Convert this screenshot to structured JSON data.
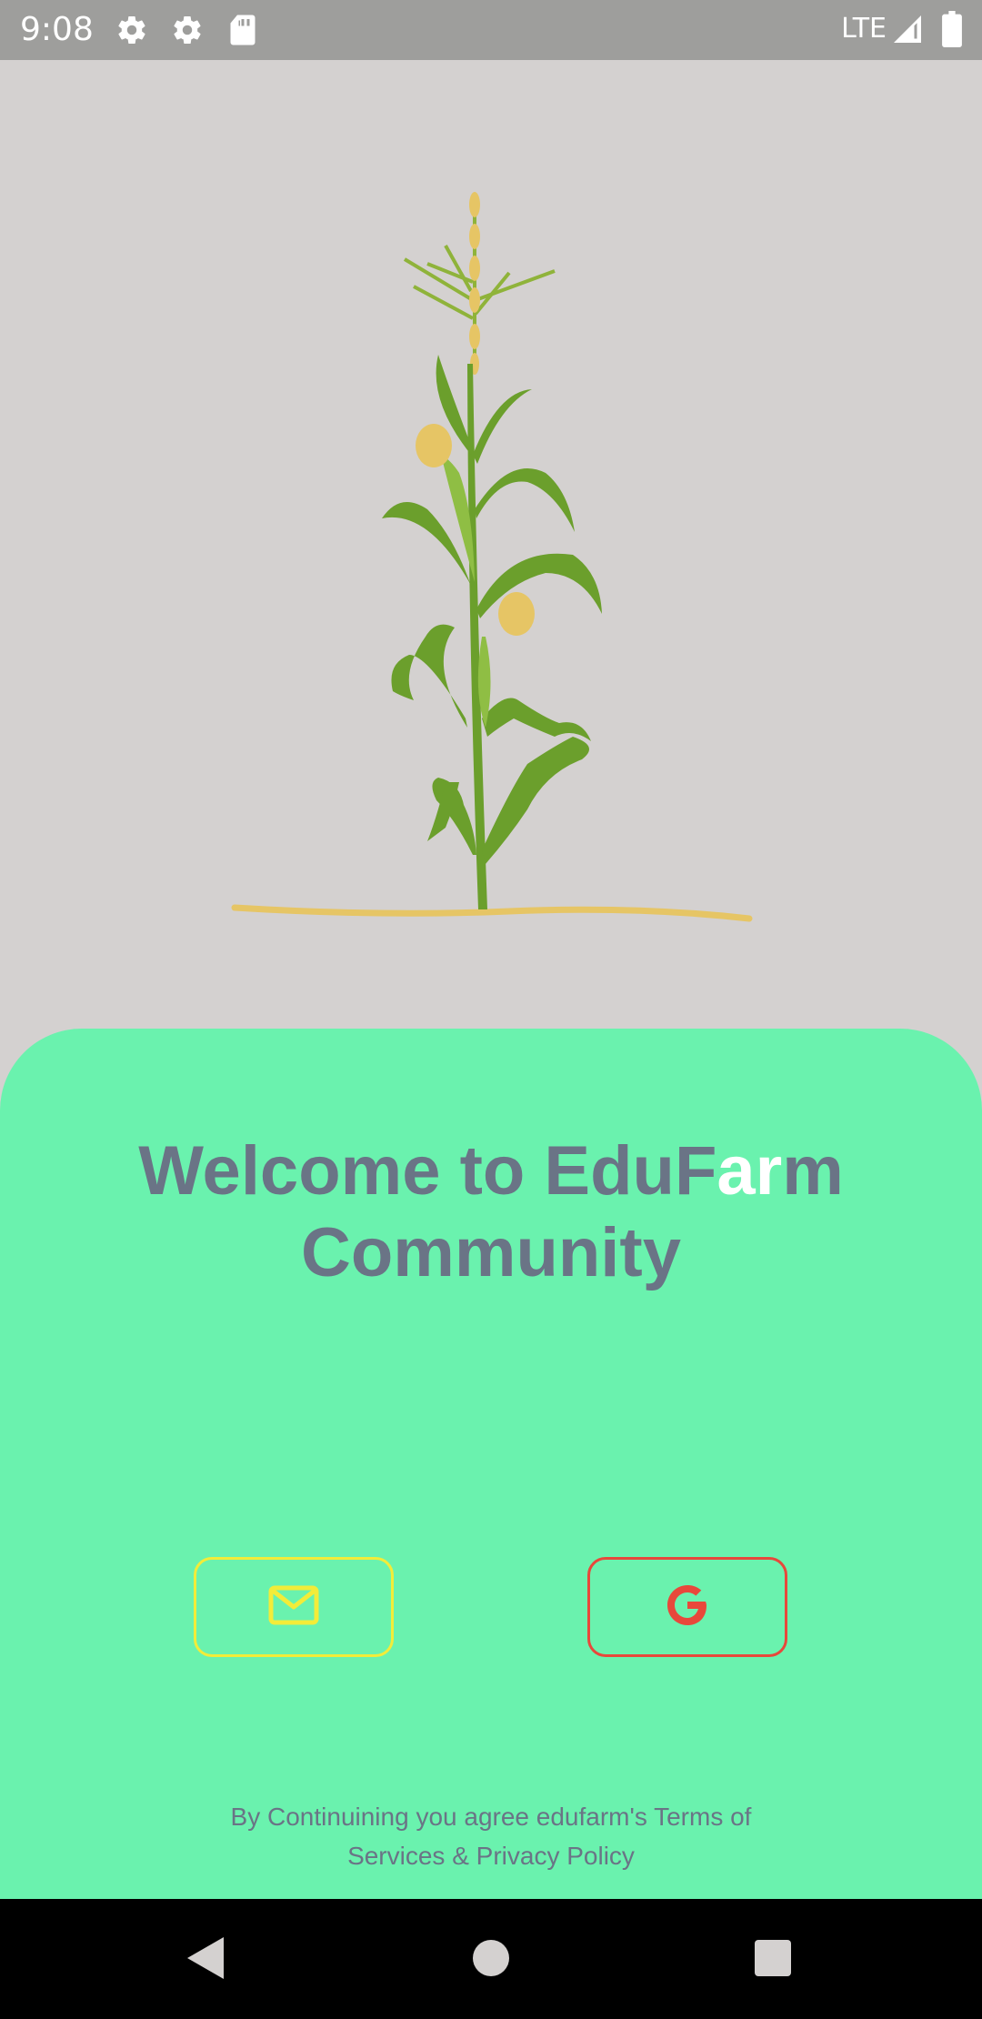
{
  "status_bar": {
    "time": "9:08",
    "left_icons": [
      "gear-icon",
      "gear-icon",
      "sd-card-icon"
    ],
    "network": "LTE",
    "right_icons": [
      "signal-icon",
      "battery-icon"
    ]
  },
  "welcome": {
    "line1_a": "Welcome to EduF",
    "line1_highlight": "ar",
    "line1_b": "m",
    "line2": "Community"
  },
  "auth": {
    "email_icon": "mail-icon",
    "google_icon": "google-icon"
  },
  "terms": {
    "line1": "By Continuining you agree edufarm's Terms of",
    "line2": "Services & Privacy Policy"
  },
  "nav": {
    "back_icon": "back-triangle-icon",
    "home_icon": "home-circle-icon",
    "recents_icon": "recents-square-icon"
  },
  "colors": {
    "background": "#d4d1d0",
    "card": "#6af2ae",
    "text": "#6a7486",
    "email_accent": "#f2ec39",
    "google_accent": "#e8483b"
  }
}
